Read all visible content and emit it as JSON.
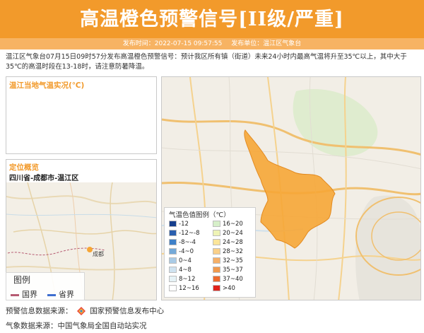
{
  "header": {
    "title": "高温橙色预警信号[II级/严重]",
    "publish_time_label": "发布时间：2022-07-15 09:57:55",
    "publisher_label": "发布单位：温江区气象台"
  },
  "description": "温江区气象台07月15日09时57分发布高温橙色预警信号：预计我区所有镇（街道）未来24小时内最高气温将升至35℃以上，其中大于35℃的高温时段在13-18时，请注意防暑降温。",
  "temp_panel": {
    "title": "温江当地气温实况(℃)"
  },
  "location_panel": {
    "title": "定位概览",
    "subtitle": "四川省-成都市-温江区",
    "map_label": "成都",
    "legend": {
      "title": "图例",
      "items": [
        {
          "label": "国界",
          "color": "#b65b72"
        },
        {
          "label": "省界",
          "color": "#3f6fd0"
        }
      ]
    }
  },
  "temp_legend": {
    "title": "气温色值图例（℃）",
    "items": [
      {
        "label": "-12",
        "color": "#163e8c"
      },
      {
        "label": "-12~-8",
        "color": "#2b5fae"
      },
      {
        "label": "-8~-4",
        "color": "#3e80c8"
      },
      {
        "label": "-4~0",
        "color": "#74a9d8"
      },
      {
        "label": "0~4",
        "color": "#a9cbe6"
      },
      {
        "label": "4~8",
        "color": "#cfe3f0"
      },
      {
        "label": "8~12",
        "color": "#e6f2f6"
      },
      {
        "label": "12~16",
        "color": "#ffffff"
      },
      {
        "label": "16~20",
        "color": "#d6efc9"
      },
      {
        "label": "20~24",
        "color": "#eef3b5"
      },
      {
        "label": "24~28",
        "color": "#fbe59a"
      },
      {
        "label": "28~32",
        "color": "#f9d089"
      },
      {
        "label": "32~35",
        "color": "#f6b068"
      },
      {
        "label": "35~37",
        "color": "#f19a4d"
      },
      {
        "label": "37~40",
        "color": "#ee6a2e"
      },
      {
        "label": ">40",
        "color": "#e0221a"
      }
    ]
  },
  "footer": {
    "warning_source_label": "预警信息数据来源：",
    "warning_source": "国家预警信息发布中心",
    "weather_source": "气象数据来源：中国气象局全国自动站实况"
  },
  "colors": {
    "accent": "#f29a2b",
    "region_fill": "#f6a636"
  }
}
